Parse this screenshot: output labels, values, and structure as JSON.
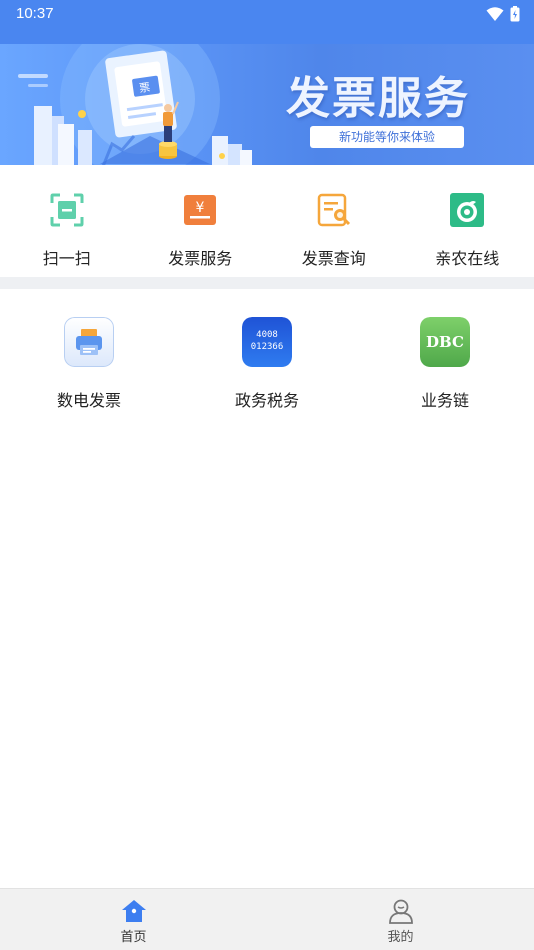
{
  "status_bar": {
    "time": "10:37"
  },
  "banner": {
    "title": "发票服务",
    "subtitle": "新功能等你来体验"
  },
  "quick_actions": [
    {
      "label": "扫一扫",
      "icon": "scan-icon"
    },
    {
      "label": "发票服务",
      "icon": "invoice-service-icon"
    },
    {
      "label": "发票查询",
      "icon": "invoice-search-icon"
    },
    {
      "label": "亲农在线",
      "icon": "qinnong-online-icon"
    }
  ],
  "apps": [
    {
      "label": "数电发票",
      "icon": "printer-icon"
    },
    {
      "label": "政务税务",
      "icon": "tax-hotline-icon",
      "icon_text_line1": "4008",
      "icon_text_line2": "012366"
    },
    {
      "label": "业务链",
      "icon": "dbc-icon",
      "icon_text": "DBC"
    }
  ],
  "bottom_nav": [
    {
      "label": "首页",
      "icon": "home-icon",
      "active": true
    },
    {
      "label": "我的",
      "icon": "profile-icon",
      "active": false
    }
  ],
  "colors": {
    "primary": "#4a86f0",
    "divider": "#eef0f3",
    "nav_bg": "#f1f1f1"
  }
}
